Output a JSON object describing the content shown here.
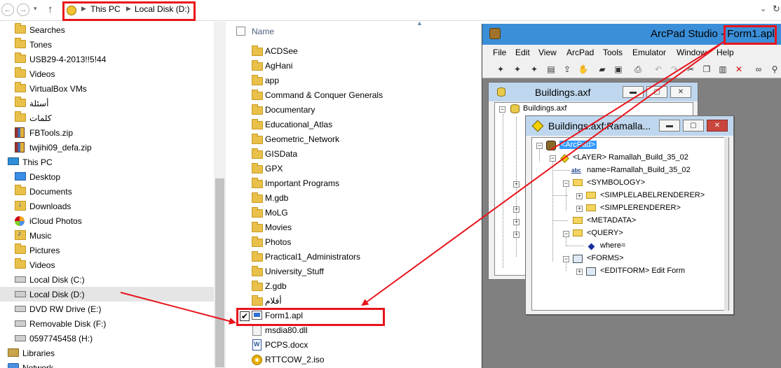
{
  "address": {
    "back_icon": "back-arrow-icon",
    "forward_icon": "forward-arrow-icon",
    "up_icon": "up-arrow-icon",
    "crumbs": [
      "This PC",
      "Local Disk (D:)"
    ],
    "dropdown_icon": "chevron-down-icon",
    "refresh_icon": "refresh-icon"
  },
  "nav": {
    "items": [
      {
        "label": "Searches",
        "icon": "folder-icon"
      },
      {
        "label": "Tones",
        "icon": "folder-icon"
      },
      {
        "label": "USB29-4-2013!!5!44",
        "icon": "folder-icon"
      },
      {
        "label": "Videos",
        "icon": "folder-icon"
      },
      {
        "label": "VirtualBox VMs",
        "icon": "folder-icon"
      },
      {
        "label": "أسئلة",
        "icon": "folder-icon"
      },
      {
        "label": "كلمات",
        "icon": "folder-icon"
      },
      {
        "label": "FBTools.zip",
        "icon": "zip-icon"
      },
      {
        "label": "twjihi09_defa.zip",
        "icon": "zip-icon"
      },
      {
        "label": "This PC",
        "icon": "computer-icon"
      },
      {
        "label": "Desktop",
        "icon": "desktop-icon"
      },
      {
        "label": "Documents",
        "icon": "folder-icon"
      },
      {
        "label": "Downloads",
        "icon": "download-icon"
      },
      {
        "label": "iCloud Photos",
        "icon": "icloud-icon"
      },
      {
        "label": "Music",
        "icon": "music-icon"
      },
      {
        "label": "Pictures",
        "icon": "folder-icon"
      },
      {
        "label": "Videos",
        "icon": "folder-icon"
      },
      {
        "label": "Local Disk (C:)",
        "icon": "drive-icon"
      },
      {
        "label": "Local Disk (D:)",
        "icon": "drive-icon"
      },
      {
        "label": "DVD RW Drive (E:)",
        "icon": "dvd-icon"
      },
      {
        "label": "Removable Disk (F:)",
        "icon": "drive-icon"
      },
      {
        "label": "0597745458 (H:)",
        "icon": "drive-icon"
      },
      {
        "label": "Libraries",
        "icon": "library-icon"
      },
      {
        "label": "Network",
        "icon": "network-icon"
      }
    ]
  },
  "files": {
    "header_name": "Name",
    "items": [
      {
        "label": "ACDSee",
        "icon": "folder-icon"
      },
      {
        "label": "AgHani",
        "icon": "folder-icon"
      },
      {
        "label": "app",
        "icon": "folder-icon"
      },
      {
        "label": "Command & Conquer Generals",
        "icon": "folder-icon"
      },
      {
        "label": "Documentary",
        "icon": "folder-icon"
      },
      {
        "label": "Educational_Atlas",
        "icon": "folder-icon"
      },
      {
        "label": "Geometric_Network",
        "icon": "folder-icon"
      },
      {
        "label": "GISData",
        "icon": "folder-icon"
      },
      {
        "label": "GPX",
        "icon": "folder-icon"
      },
      {
        "label": "Important Programs",
        "icon": "folder-icon"
      },
      {
        "label": "M.gdb",
        "icon": "folder-icon"
      },
      {
        "label": "MoLG",
        "icon": "folder-icon"
      },
      {
        "label": "Movies",
        "icon": "folder-icon"
      },
      {
        "label": "Photos",
        "icon": "folder-icon"
      },
      {
        "label": "Practical1_Administrators",
        "icon": "folder-icon"
      },
      {
        "label": "University_Stuff",
        "icon": "folder-icon"
      },
      {
        "label": "Z.gdb",
        "icon": "folder-icon"
      },
      {
        "label": "أفلام",
        "icon": "folder-icon"
      },
      {
        "label": "Form1.apl",
        "icon": "apl-file-icon"
      },
      {
        "label": "msdia80.dll",
        "icon": "dll-file-icon"
      },
      {
        "label": "PCPS.docx",
        "icon": "word-doc-icon"
      },
      {
        "label": "RTTCOW_2.iso",
        "icon": "iso-file-icon"
      }
    ]
  },
  "studio": {
    "title": "ArcPad Studio - Form1.apl",
    "menu": [
      "File",
      "Edit",
      "View",
      "ArcPad",
      "Tools",
      "Emulator",
      "Window",
      "Help"
    ],
    "toolbar_icons": [
      "wand-icon",
      "wand-icon",
      "wand-icon",
      "script-icon",
      "export-icon",
      "hand-icon",
      "open-folder-icon",
      "save-icon",
      "print-icon",
      "undo-icon",
      "redo-icon",
      "cut-icon",
      "copy-icon",
      "paste-icon",
      "delete-icon",
      "binoculars-icon",
      "find-replace-icon"
    ],
    "win1": {
      "title": "Buildings.axf",
      "root": "Buildings.axf",
      "min_label": "▬",
      "max_label": "▢",
      "close_label": "✕"
    },
    "win2": {
      "title": "Buildings.axf:Ramalla...",
      "min_label": "▬",
      "max_label": "▢",
      "close_label": "✕",
      "nodes": [
        "<ArcPad>",
        "<LAYER> Ramallah_Build_35_02",
        "name=Ramallah_Build_35_02",
        "<SYMBOLOGY>",
        "<SIMPLELABELRENDERER>",
        "<SIMPLERENDERER>",
        "<METADATA>",
        "<QUERY>",
        "where=",
        "<FORMS>",
        "<EDITFORM> Edit Form"
      ]
    }
  },
  "annotations": {
    "highlight_color": "#e8141b",
    "check_mark": "✔"
  }
}
